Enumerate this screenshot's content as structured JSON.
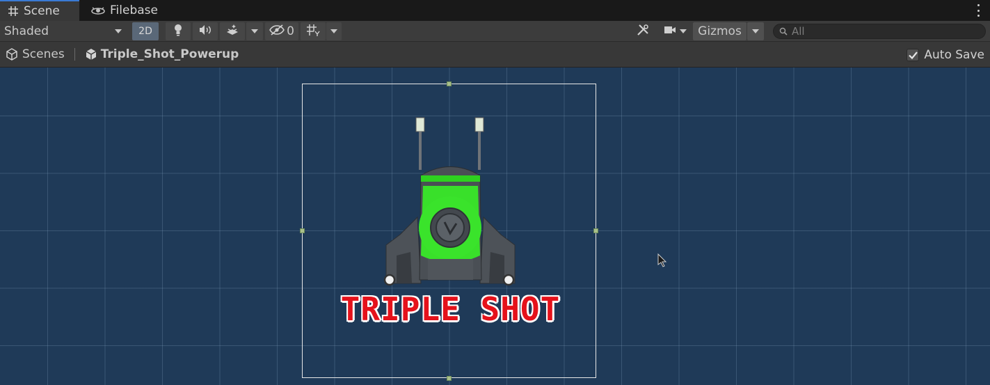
{
  "tabs": {
    "scene_label": "Scene",
    "filebase_label": "Filebase"
  },
  "toolbar": {
    "draw_mode": "Shaded",
    "mode_2d": "2D",
    "hidden_count": "0",
    "gizmos_label": "Gizmos",
    "search_placeholder": "All"
  },
  "breadcrumb": {
    "scenes_label": "Scenes",
    "object_label": "Triple_Shot_Powerup"
  },
  "autosave": {
    "label": "Auto Save",
    "checked": true
  },
  "viewport": {
    "sprite_text": "TRIPLE SHOT",
    "colors": {
      "background": "#1f3a58",
      "grid": "#6f8aa5",
      "sprite_green": "#39e02a",
      "sprite_red": "#e5121b"
    }
  }
}
